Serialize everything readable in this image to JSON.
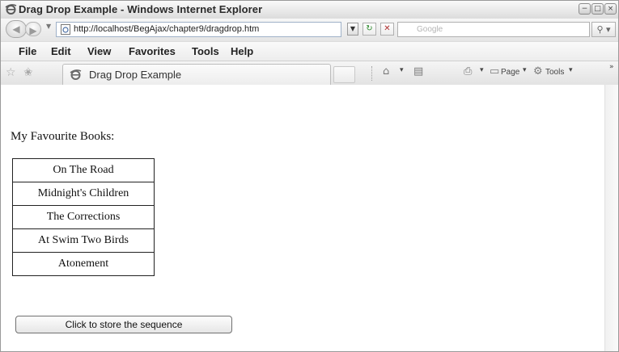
{
  "window": {
    "title": "Drag Drop Example - Windows Internet Explorer"
  },
  "address": {
    "url": "http://localhost/BegAjax/chapter9/dragdrop.htm",
    "search_placeholder": "Google"
  },
  "menu": [
    "File",
    "Edit",
    "View",
    "Favorites",
    "Tools",
    "Help"
  ],
  "tab": {
    "title": "Drag Drop Example"
  },
  "commands": {
    "page_label": "Page",
    "tools_label": "Tools"
  },
  "content": {
    "heading": "My Favourite Books:",
    "books": [
      "On The Road",
      "Midnight's Children",
      "The Corrections",
      "At Swim Two Birds",
      "Atonement"
    ],
    "store_button": "Click to store the sequence"
  }
}
